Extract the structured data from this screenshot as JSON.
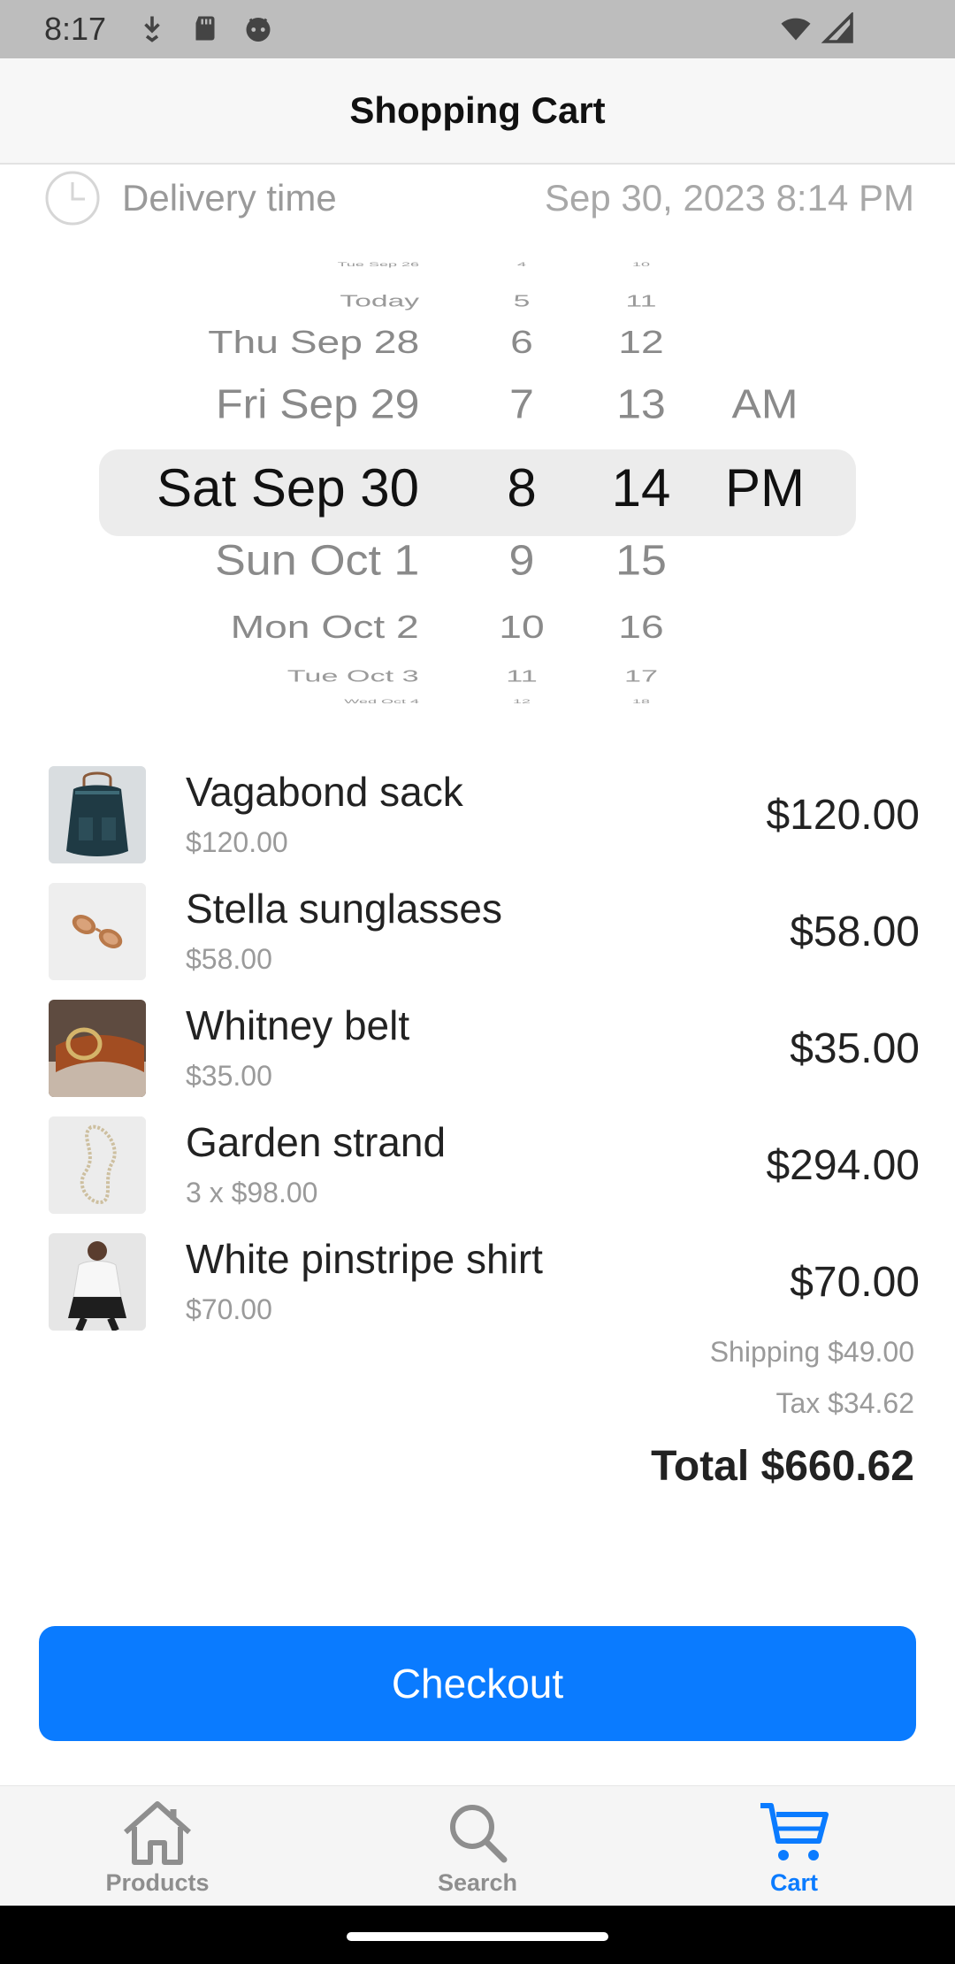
{
  "status_bar": {
    "time": "8:17",
    "icons": [
      "download-icon",
      "sd-card-icon",
      "android-face-icon",
      "wifi-icon",
      "signal-icon"
    ]
  },
  "header": {
    "title": "Shopping Cart"
  },
  "delivery": {
    "icon": "clock-icon",
    "label": "Delivery time",
    "value": "Sep 30, 2023 8:14 PM"
  },
  "picker": {
    "dates": [
      "Tue Sep 26",
      "Today",
      "Thu Sep 28",
      "Fri Sep 29",
      "Sat Sep 30",
      "Sun Oct 1",
      "Mon Oct 2",
      "Tue Oct 3",
      "Wed Oct 4"
    ],
    "hours": [
      "4",
      "5",
      "6",
      "7",
      "8",
      "9",
      "10",
      "11",
      "12"
    ],
    "minutes": [
      "10",
      "11",
      "12",
      "13",
      "14",
      "15",
      "16",
      "17",
      "18"
    ],
    "ampm": [
      "",
      "",
      "",
      "AM",
      "PM",
      "",
      "",
      "",
      ""
    ],
    "selected_index": 4
  },
  "cart": {
    "items": [
      {
        "name": "Vagabond sack",
        "sub": "$120.00",
        "price": "$120.00",
        "thumb": "backpack-image"
      },
      {
        "name": "Stella sunglasses",
        "sub": "$58.00",
        "price": "$58.00",
        "thumb": "sunglasses-image"
      },
      {
        "name": "Whitney belt",
        "sub": "$35.00",
        "price": "$35.00",
        "thumb": "belt-image"
      },
      {
        "name": "Garden strand",
        "sub": "3 x $98.00",
        "price": "$294.00",
        "thumb": "necklace-image"
      },
      {
        "name": "White pinstripe shirt",
        "sub": "$70.00",
        "price": "$70.00",
        "thumb": "shirt-image"
      }
    ],
    "shipping": "Shipping $49.00",
    "tax": "Tax $34.62",
    "total": "Total $660.62"
  },
  "checkout_label": "Checkout",
  "tabs": [
    {
      "label": "Products",
      "icon": "home-icon",
      "active": false
    },
    {
      "label": "Search",
      "icon": "search-icon",
      "active": false
    },
    {
      "label": "Cart",
      "icon": "cart-icon",
      "active": true
    }
  ],
  "colors": {
    "accent": "#0a7bff",
    "highlight": "#ececec"
  }
}
